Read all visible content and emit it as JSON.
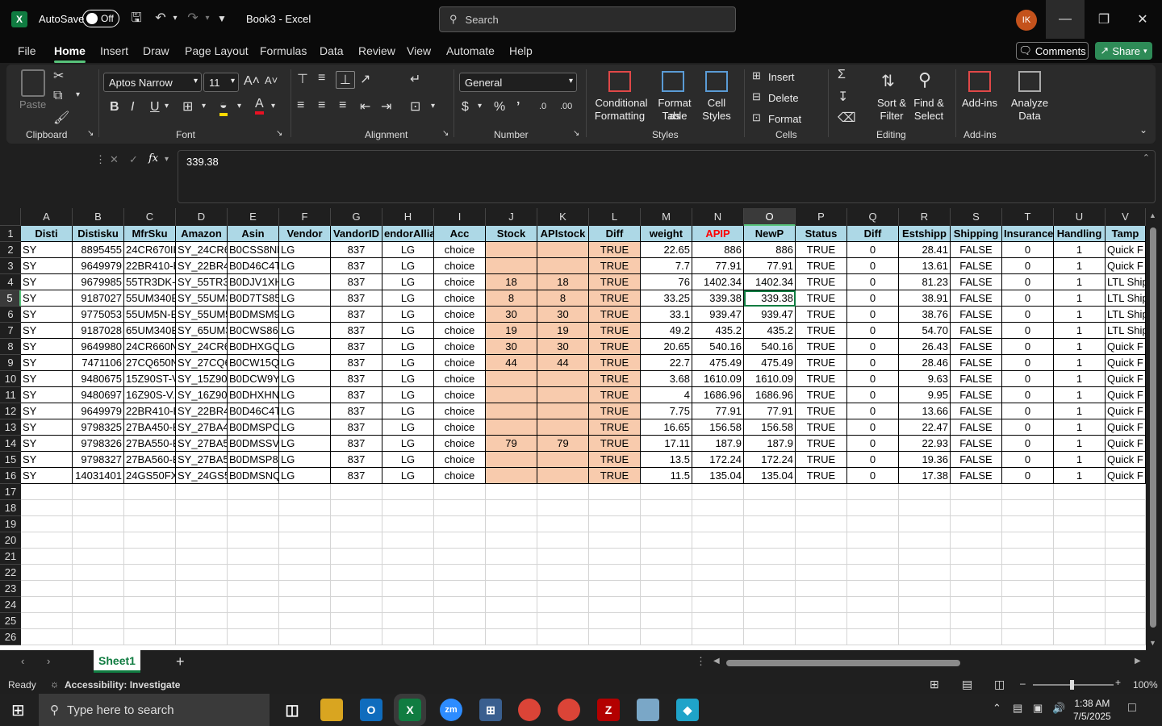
{
  "app": {
    "autosave_label": "AutoSave",
    "autosave_state": "Off",
    "title": "Book3 - Excel",
    "search_placeholder": "Search",
    "avatar_initials": "IK"
  },
  "menu": {
    "items": [
      "File",
      "Home",
      "Insert",
      "Draw",
      "Page Layout",
      "Formulas",
      "Data",
      "Review",
      "View",
      "Automate",
      "Help"
    ],
    "comments_label": "Comments",
    "share_label": "Share"
  },
  "ribbon": {
    "paste_label": "Paste",
    "font_name": "Aptos Narrow",
    "font_size": "11",
    "number_format": "General",
    "conditional_formatting": [
      "Conditional",
      "Formatting"
    ],
    "format_as_table": [
      "Format as",
      "Table"
    ],
    "cell_styles": [
      "Cell",
      "Styles"
    ],
    "insert_label": "Insert",
    "delete_label": "Delete",
    "format_label": "Format",
    "sort_filter": [
      "Sort &",
      "Filter"
    ],
    "find_select": [
      "Find &",
      "Select"
    ],
    "addins_label": "Add-ins",
    "analyze_data": [
      "Analyze",
      "Data"
    ],
    "groups": [
      "Clipboard",
      "Font",
      "Alignment",
      "Number",
      "Styles",
      "Cells",
      "Editing",
      "Add-ins"
    ]
  },
  "formula_bar": {
    "name_box": "O5",
    "fx_label": "fx",
    "value": "339.38"
  },
  "columns": [
    "A",
    "B",
    "C",
    "D",
    "E",
    "F",
    "G",
    "H",
    "I",
    "J",
    "K",
    "L",
    "M",
    "N",
    "O",
    "P",
    "Q",
    "R",
    "S",
    "T",
    "U",
    "V"
  ],
  "row_numbers": [
    "1",
    "2",
    "3",
    "4",
    "5",
    "6",
    "7",
    "8",
    "9",
    "10",
    "11",
    "12",
    "13",
    "14",
    "15",
    "16",
    "17",
    "18",
    "19",
    "20",
    "21",
    "22",
    "23",
    "24",
    "25",
    "26"
  ],
  "headers": [
    "Disti",
    "Distisku",
    "MfrSku",
    "Amazon",
    "Asin",
    "Vendor",
    "VandorID",
    "endorAllia",
    "Acc",
    "Stock",
    "APIstock",
    "Diff",
    "weight",
    "APIP",
    "NewP",
    "Status",
    "Diff",
    "Estshipp",
    "Shipping",
    "Insurance",
    "Handling",
    "Tamp"
  ],
  "rows": [
    [
      "SY",
      "8895455",
      "24CR670IK",
      "SY_24CR67",
      "B0CSS8NK",
      "LG",
      "837",
      "LG",
      "choice",
      "",
      "",
      "TRUE",
      "22.65",
      "886",
      "886",
      "TRUE",
      "0",
      "28.41",
      "FALSE",
      "0",
      "1",
      "Quick F"
    ],
    [
      "SY",
      "9649979",
      "22BR410-B",
      "SY_22BR41",
      "B0D46C4T",
      "LG",
      "837",
      "LG",
      "choice",
      "",
      "",
      "TRUE",
      "7.7",
      "77.91",
      "77.91",
      "TRUE",
      "0",
      "13.61",
      "FALSE",
      "0",
      "1",
      "Quick F"
    ],
    [
      "SY",
      "9679985",
      "55TR3DK-B",
      "SY_55TR3D",
      "B0DJV1XH",
      "LG",
      "837",
      "LG",
      "choice",
      "18",
      "18",
      "TRUE",
      "76",
      "1402.34",
      "1402.34",
      "TRUE",
      "0",
      "81.23",
      "FALSE",
      "0",
      "1",
      "LTL Ship"
    ],
    [
      "SY",
      "9187027",
      "55UM340E",
      "SY_55UM3",
      "B0D7TS85",
      "LG",
      "837",
      "LG",
      "choice",
      "8",
      "8",
      "TRUE",
      "33.25",
      "339.38",
      "339.38",
      "TRUE",
      "0",
      "38.91",
      "FALSE",
      "0",
      "1",
      "LTL Ship"
    ],
    [
      "SY",
      "9775053",
      "55UM5N-B",
      "SY_55UM5",
      "B0DMSM9",
      "LG",
      "837",
      "LG",
      "choice",
      "30",
      "30",
      "TRUE",
      "33.1",
      "939.47",
      "939.47",
      "TRUE",
      "0",
      "38.76",
      "FALSE",
      "0",
      "1",
      "LTL Ship"
    ],
    [
      "SY",
      "9187028",
      "65UM340E",
      "SY_65UM3",
      "B0CWS86L",
      "LG",
      "837",
      "LG",
      "choice",
      "19",
      "19",
      "TRUE",
      "49.2",
      "435.2",
      "435.2",
      "TRUE",
      "0",
      "54.70",
      "FALSE",
      "0",
      "1",
      "LTL Ship"
    ],
    [
      "SY",
      "9649980",
      "24CR660N",
      "SY_24CR66",
      "B0DHXGQ",
      "LG",
      "837",
      "LG",
      "choice",
      "30",
      "30",
      "TRUE",
      "20.65",
      "540.16",
      "540.16",
      "TRUE",
      "0",
      "26.43",
      "FALSE",
      "0",
      "1",
      "Quick F"
    ],
    [
      "SY",
      "7471106",
      "27CQ650N",
      "SY_27CQ6",
      "B0CW15Q",
      "LG",
      "837",
      "LG",
      "choice",
      "44",
      "44",
      "TRUE",
      "22.7",
      "475.49",
      "475.49",
      "TRUE",
      "0",
      "28.46",
      "FALSE",
      "0",
      "1",
      "Quick F"
    ],
    [
      "SY",
      "9480675",
      "15Z90ST-V",
      "SY_15Z90S",
      "B0DCW9Y",
      "LG",
      "837",
      "LG",
      "choice",
      "",
      "",
      "TRUE",
      "3.68",
      "1610.09",
      "1610.09",
      "TRUE",
      "0",
      "9.63",
      "FALSE",
      "0",
      "1",
      "Quick F"
    ],
    [
      "SY",
      "9480697",
      "16Z90S-V.",
      "SY_16Z90S",
      "B0DHXHN",
      "LG",
      "837",
      "LG",
      "choice",
      "",
      "",
      "TRUE",
      "4",
      "1686.96",
      "1686.96",
      "TRUE",
      "0",
      "9.95",
      "FALSE",
      "0",
      "1",
      "Quick F"
    ],
    [
      "SY",
      "9649979",
      "22BR410-B",
      "SY_22BR41",
      "B0D46C4T",
      "LG",
      "837",
      "LG",
      "choice",
      "",
      "",
      "TRUE",
      "7.75",
      "77.91",
      "77.91",
      "TRUE",
      "0",
      "13.66",
      "FALSE",
      "0",
      "1",
      "Quick F"
    ],
    [
      "SY",
      "9798325",
      "27BA450-B",
      "SY_27BA45",
      "B0DMSPC",
      "LG",
      "837",
      "LG",
      "choice",
      "",
      "",
      "TRUE",
      "16.65",
      "156.58",
      "156.58",
      "TRUE",
      "0",
      "22.47",
      "FALSE",
      "0",
      "1",
      "Quick F"
    ],
    [
      "SY",
      "9798326",
      "27BA550-B",
      "SY_27BA55",
      "B0DMSSV",
      "LG",
      "837",
      "LG",
      "choice",
      "79",
      "79",
      "TRUE",
      "17.11",
      "187.9",
      "187.9",
      "TRUE",
      "0",
      "22.93",
      "FALSE",
      "0",
      "1",
      "Quick F"
    ],
    [
      "SY",
      "9798327",
      "27BA560-B",
      "SY_27BA56",
      "B0DMSP8",
      "LG",
      "837",
      "LG",
      "choice",
      "",
      "",
      "TRUE",
      "13.5",
      "172.24",
      "172.24",
      "TRUE",
      "0",
      "19.36",
      "FALSE",
      "0",
      "1",
      "Quick F"
    ],
    [
      "SY",
      "14031401",
      "24GS50FX",
      "SY_24GS5",
      "B0DMSNQ",
      "LG",
      "837",
      "LG",
      "choice",
      "",
      "",
      "TRUE",
      "11.5",
      "135.04",
      "135.04",
      "TRUE",
      "0",
      "17.38",
      "FALSE",
      "0",
      "1",
      "Quick F"
    ]
  ],
  "sheet": {
    "tab": "Sheet1"
  },
  "status": {
    "ready": "Ready",
    "accessibility": "Accessibility: Investigate",
    "zoom": "100%"
  },
  "taskbar": {
    "search_placeholder": "Type here to search",
    "time": "1:38 AM",
    "date": "7/5/2025"
  },
  "colors": {
    "header_fill": "#add8e6",
    "peach_fill": "#f8cbad",
    "apip_header_text": "#ff0000",
    "excel_green": "#107c41"
  }
}
